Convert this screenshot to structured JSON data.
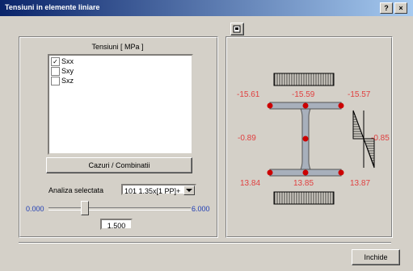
{
  "window": {
    "title": "Tensiuni in elemente liniare",
    "help_label": "?",
    "close_label": "×"
  },
  "toolbar": {
    "icon": "export-icon"
  },
  "left_panel": {
    "title": "Tensiuni [ MPa ]",
    "stress_options": [
      {
        "label": "Sxx",
        "checked": true
      },
      {
        "label": "Sxy",
        "checked": false
      },
      {
        "label": "Sxz",
        "checked": false
      }
    ],
    "cases_button": "Cazuri / Combinatii",
    "analysis_label": "Analiza selectata",
    "analysis_value": "101 1.35x[1 PP]+",
    "slider": {
      "min_label": "0.000",
      "max_label": "6.000",
      "value": "1.500",
      "fraction": 0.25
    }
  },
  "diagram": {
    "top_left": "-15.61",
    "top_mid": "-15.59",
    "top_right": "-15.57",
    "mid_left": "-0.89",
    "mid_right": "-0.85",
    "bot_left": "13.84",
    "bot_mid": "13.85",
    "bot_right": "13.87"
  },
  "footer": {
    "close_button": "Inchide"
  },
  "colors": {
    "stress_value": "#e04040",
    "axis_value": "#1e3cb4",
    "point": "#cc0000"
  }
}
